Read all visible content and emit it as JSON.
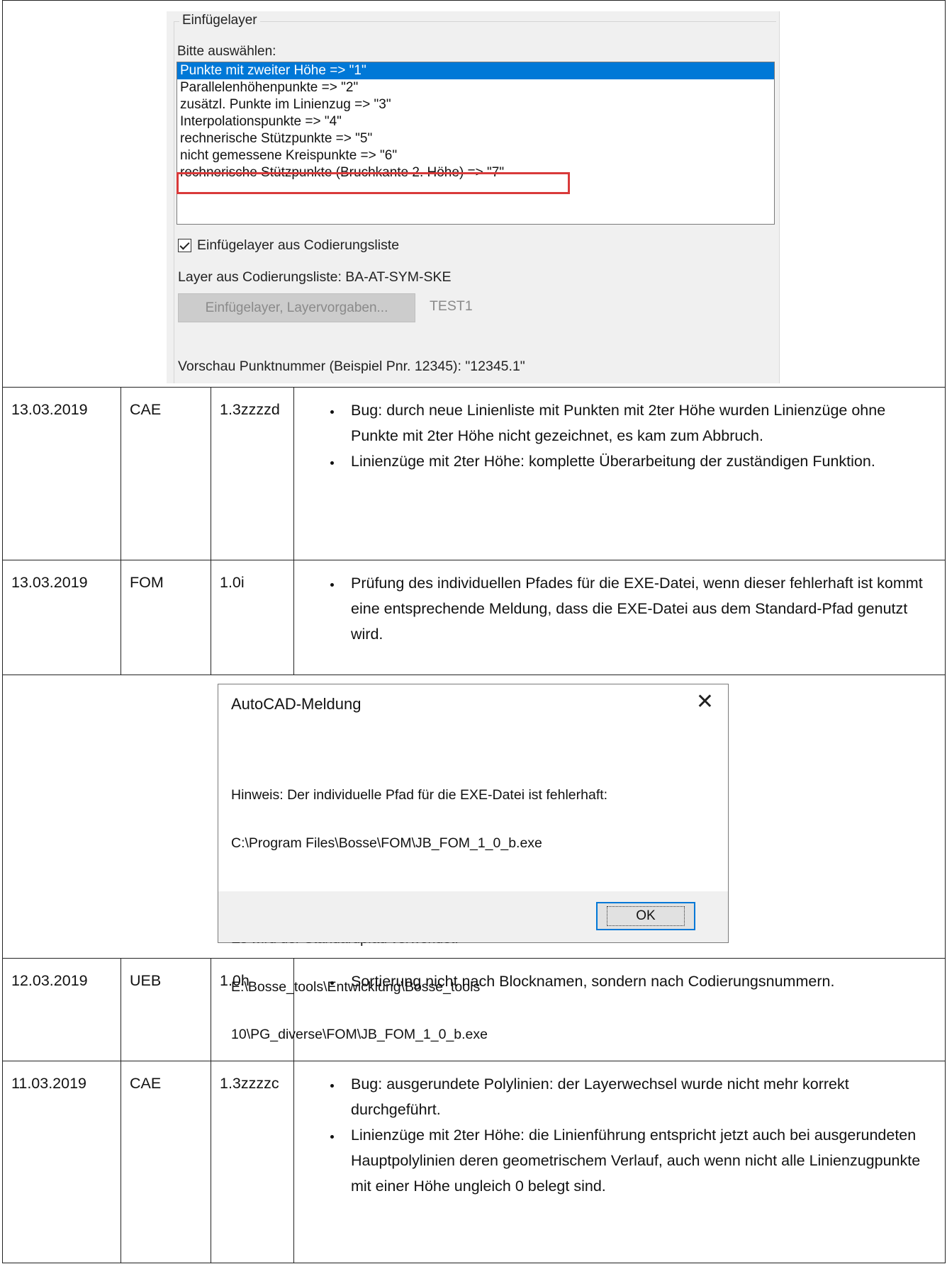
{
  "panel": {
    "group_title": "Einfügelayer",
    "prompt": "Bitte auswählen:",
    "list_items": [
      "Punkte mit zweiter Höhe => \"1\"",
      "Parallelenhöhenpunkte => \"2\"",
      "zusätzl. Punkte im Linienzug => \"3\"",
      "Interpolationspunkte => \"4\"",
      "rechnerische Stützpunkte => \"5\"",
      "nicht gemessene Kreispunkte => \"6\"",
      "rechnerische Stützpunkte (Bruchkante 2. Höhe) => \"7\""
    ],
    "selected_index": 0,
    "highlighted_index": 6,
    "checkbox_label": "Einfügelayer aus Codierungsliste",
    "checkbox_checked": true,
    "layer_line": "Layer aus Codierungsliste: BA-AT-SYM-SKE",
    "button_label": "Einfügelayer, Layervorgaben...",
    "button_value": "TEST1",
    "preview": "Vorschau Punktnummer (Beispiel Pnr. 12345): \"12345.1\""
  },
  "rows": [
    {
      "date": "13.03.2019",
      "code": "CAE",
      "version": "1.3zzzzd",
      "bullets": [
        "Bug: durch neue Linienliste mit Punkten mit 2ter Höhe wurden Linienzüge ohne Punkte mit 2ter Höhe nicht gezeichnet, es kam zum Abbruch.",
        "Linienzüge mit 2ter Höhe: komplette Überarbeitung der zuständigen Funktion."
      ]
    },
    {
      "date": "13.03.2019",
      "code": "FOM",
      "version": "1.0i",
      "bullets": [
        "Prüfung des individuellen Pfades für die EXE-Datei, wenn dieser fehlerhaft ist kommt eine entsprechende Meldung, dass die EXE-Datei aus dem Standard-Pfad genutzt wird."
      ]
    },
    {
      "date": "12.03.2019",
      "code": "UEB",
      "version": "1.0h",
      "bullets": [
        "Sortierung nicht nach Blocknamen, sondern nach Codierungsnummern."
      ]
    },
    {
      "date": "11.03.2019",
      "code": "CAE",
      "version": "1.3zzzzc",
      "bullets": [
        "Bug: ausgerundete Polylinien: der Layerwechsel wurde nicht mehr korrekt durchgeführt.",
        "Linienzüge mit 2ter Höhe: die Linienführung entspricht jetzt auch bei ausgerundeten Hauptpolylinien deren geometrischem Verlauf, auch wenn nicht alle Linienzugpunkte mit einer Höhe ungleich 0 belegt sind."
      ]
    }
  ],
  "dialog": {
    "title": "AutoCAD-Meldung",
    "close_glyph": "✕",
    "lines1": [
      "Hinweis: Der individuelle Pfad für die EXE-Datei ist fehlerhaft:",
      "C:\\Program Files\\Bosse\\FOM\\JB_FOM_1_0_b.exe"
    ],
    "lines2": [
      "Es wird der Standardpfad verwendet:",
      "E:\\Bosse_tools\\Entwicklung\\Bosse_tools",
      "10\\PG_diverse\\FOM\\JB_FOM_1_0_b.exe"
    ],
    "ok_label": "OK"
  },
  "icons": {
    "checkbox": "checkmark-icon",
    "close": "close-icon"
  },
  "colors": {
    "selection": "#0078d7",
    "highlight_box": "#d93a3a",
    "disabled_button": "#cccccc"
  }
}
